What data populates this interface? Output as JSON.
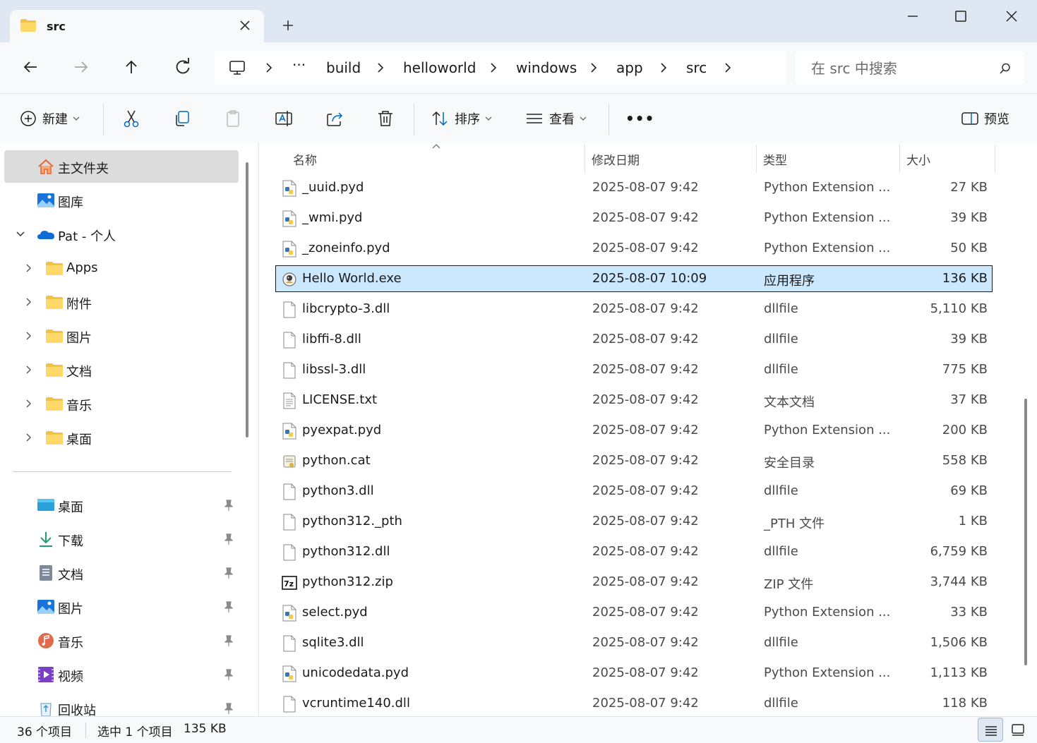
{
  "window": {
    "tab_title": "src",
    "new_tab_symbol": "+"
  },
  "address": {
    "ellipsis": "···",
    "breadcrumbs": [
      "build",
      "helloworld",
      "windows",
      "app",
      "src"
    ],
    "search_placeholder": "在 src 中搜索"
  },
  "commands": {
    "new_label": "新建",
    "sort_label": "排序",
    "view_label": "查看",
    "more_label": "•••",
    "preview_label": "预览"
  },
  "sidebar": {
    "home": "主文件夹",
    "gallery": "图库",
    "onedrive": "Pat - 个人",
    "onedrive_items": [
      "Apps",
      "附件",
      "图片",
      "文档",
      "音乐",
      "桌面"
    ],
    "quick_access": [
      "桌面",
      "下载",
      "文档",
      "图片",
      "音乐",
      "视频",
      "回收站"
    ]
  },
  "columns": {
    "name": "名称",
    "date": "修改日期",
    "type": "类型",
    "size": "大小"
  },
  "files": [
    {
      "name": "_uuid.pyd",
      "date": "2025-08-07 9:42",
      "type": "Python Extension ...",
      "size": "27 KB",
      "icon": "python-file-icon"
    },
    {
      "name": "_wmi.pyd",
      "date": "2025-08-07 9:42",
      "type": "Python Extension ...",
      "size": "39 KB",
      "icon": "python-file-icon"
    },
    {
      "name": "_zoneinfo.pyd",
      "date": "2025-08-07 9:42",
      "type": "Python Extension ...",
      "size": "50 KB",
      "icon": "python-file-icon"
    },
    {
      "name": "Hello World.exe",
      "date": "2025-08-07 10:09",
      "type": "应用程序",
      "size": "136 KB",
      "icon": "application-icon"
    },
    {
      "name": "libcrypto-3.dll",
      "date": "2025-08-07 9:42",
      "type": "dllfile",
      "size": "5,110 KB",
      "icon": "blank-file-icon"
    },
    {
      "name": "libffi-8.dll",
      "date": "2025-08-07 9:42",
      "type": "dllfile",
      "size": "39 KB",
      "icon": "blank-file-icon"
    },
    {
      "name": "libssl-3.dll",
      "date": "2025-08-07 9:42",
      "type": "dllfile",
      "size": "775 KB",
      "icon": "blank-file-icon"
    },
    {
      "name": "LICENSE.txt",
      "date": "2025-08-07 9:42",
      "type": "文本文档",
      "size": "37 KB",
      "icon": "text-file-icon"
    },
    {
      "name": "pyexpat.pyd",
      "date": "2025-08-07 9:42",
      "type": "Python Extension ...",
      "size": "200 KB",
      "icon": "python-file-icon"
    },
    {
      "name": "python.cat",
      "date": "2025-08-07 9:42",
      "type": "安全目录",
      "size": "558 KB",
      "icon": "catalog-file-icon"
    },
    {
      "name": "python3.dll",
      "date": "2025-08-07 9:42",
      "type": "dllfile",
      "size": "69 KB",
      "icon": "blank-file-icon"
    },
    {
      "name": "python312._pth",
      "date": "2025-08-07 9:42",
      "type": "_PTH 文件",
      "size": "1 KB",
      "icon": "blank-file-icon"
    },
    {
      "name": "python312.dll",
      "date": "2025-08-07 9:42",
      "type": "dllfile",
      "size": "6,759 KB",
      "icon": "blank-file-icon"
    },
    {
      "name": "python312.zip",
      "date": "2025-08-07 9:42",
      "type": "ZIP 文件",
      "size": "3,744 KB",
      "icon": "7zip-archive-icon"
    },
    {
      "name": "select.pyd",
      "date": "2025-08-07 9:42",
      "type": "Python Extension ...",
      "size": "33 KB",
      "icon": "python-file-icon"
    },
    {
      "name": "sqlite3.dll",
      "date": "2025-08-07 9:42",
      "type": "dllfile",
      "size": "1,506 KB",
      "icon": "blank-file-icon"
    },
    {
      "name": "unicodedata.pyd",
      "date": "2025-08-07 9:42",
      "type": "Python Extension ...",
      "size": "1,113 KB",
      "icon": "python-file-icon"
    },
    {
      "name": "vcruntime140.dll",
      "date": "2025-08-07 9:42",
      "type": "dllfile",
      "size": "118 KB",
      "icon": "blank-file-icon"
    }
  ],
  "selected_file": "Hello World.exe",
  "status": {
    "item_count": "36 个项目",
    "selection": "选中 1 个项目",
    "selection_size": "135 KB"
  },
  "colors": {
    "accent": "#0067c0",
    "selection_bg": "#cce8ff",
    "folder": "#f5c142"
  }
}
